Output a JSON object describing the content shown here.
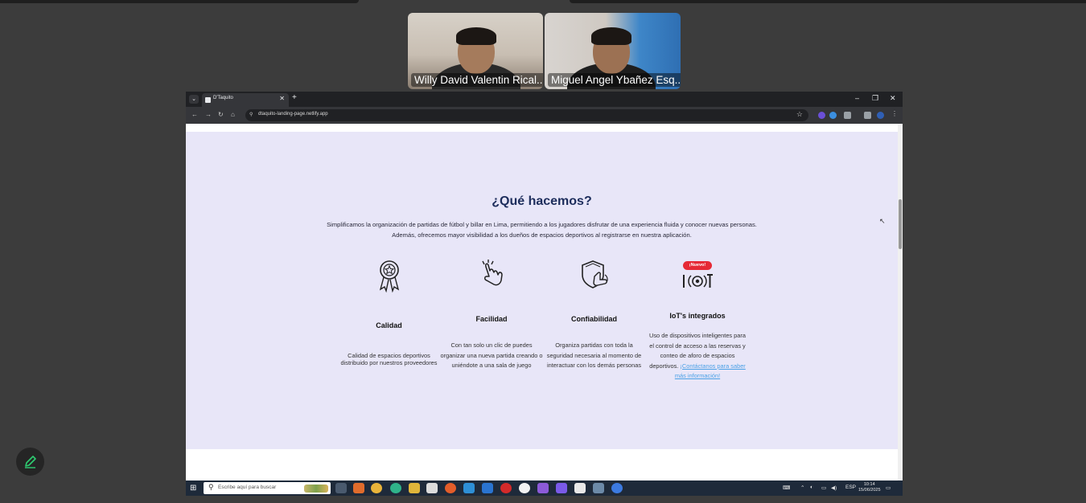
{
  "meeting": {
    "participants": [
      {
        "name": "Willy David Valentin Rical..."
      },
      {
        "name": "Miguel Angel Ybañez Esq..."
      }
    ]
  },
  "browser": {
    "tab_title": "D'Taquito",
    "new_tab_symbol": "+",
    "tab_close_symbol": "✕",
    "url": "dtaquito-landing-page.netlify.app",
    "window_controls": {
      "minimize": "–",
      "restore": "❐",
      "close": "✕"
    }
  },
  "page": {
    "heading": "¿Qué hacemos?",
    "intro": "Simplificamos la organización de partidas de fútbol y billar en Lima, permitiendo a los jugadores disfrutar de una experiencia fluida y conocer nuevas personas. Además, ofrecemos mayor visibilidad a los dueños de espacios deportivos al registrarse en nuestra aplicación.",
    "features": [
      {
        "title": "Calidad",
        "description": "Calidad de espacios deportivos distribuido por nuestros proveedores",
        "icon": "award-medal-icon"
      },
      {
        "title": "Facilidad",
        "description": "Con tan solo un clic de puedes organizar una nueva partida creando o uniéndote a una sala de juego",
        "icon": "finger-tap-icon"
      },
      {
        "title": "Confiabilidad",
        "description": "Organiza partidas con toda la seguridad necesaria al momento de interactuar con los demás personas",
        "icon": "shield-hand-icon"
      },
      {
        "title": "IoT's integrados",
        "description": "Uso de dispositivos inteligentes para el control de acceso a las reservas y conteo de aforo de espacios deportivos.",
        "link_text": "¡Contáctanos para saber más información!",
        "badge": "¡Nuevo!",
        "icon": "iot-icon"
      }
    ]
  },
  "taskbar": {
    "search_placeholder": "Escribe aquí para buscar",
    "language": "ESP",
    "time": "10:14",
    "date": "15/06/2025"
  },
  "colors": {
    "section_background": "#e8e6f8",
    "heading": "#1d2d5c",
    "link": "#4aa0e6",
    "badge": "#e62a36"
  }
}
